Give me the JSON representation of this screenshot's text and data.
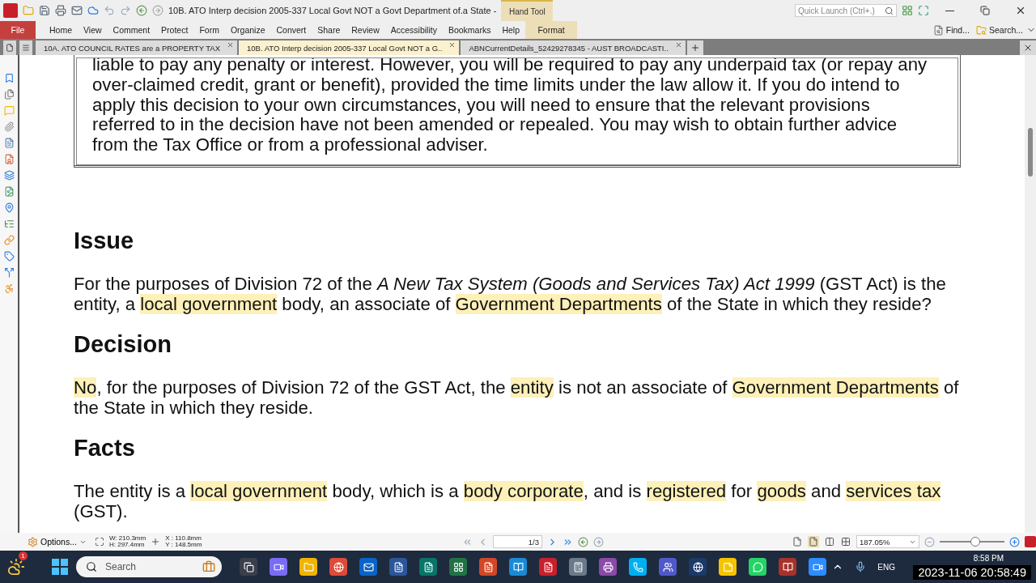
{
  "title_bar": {
    "title": "10B. ATO Interp decision 2005-337 Local Govt NOT a Govt Department of.a State -",
    "context_group": "Hand Tool",
    "quick_launch": {
      "placeholder": "Quick Launch (Ctrl+.)"
    }
  },
  "menu": {
    "file": "File",
    "items": [
      "Home",
      "View",
      "Comment",
      "Protect",
      "Form",
      "Organize",
      "Convert",
      "Share",
      "Review",
      "Accessibility",
      "Bookmarks",
      "Help"
    ],
    "context_tab": "Format",
    "tools": [
      "Find...",
      "Search..."
    ]
  },
  "doc_tabs": [
    {
      "label": "10A. ATO COUNCIL RATES are a PROPERTY TAX",
      "selected": false
    },
    {
      "label": "10B. ATO Interp decision 2005-337 Local Govt NOT a G..",
      "selected": true
    },
    {
      "label": "ABNCurrentDetails_52429278345 - AUST BROADCASTI..",
      "selected": false
    }
  ],
  "document": {
    "notice": "liable to pay any penalty or interest. However, you will be required to pay any underpaid tax (or repay any over-claimed credit, grant or benefit), provided the time limits under the law allow it. If you do intend to apply this decision to your own circumstances, you will need to ensure that the relevant provisions referred to in the decision have not been amended or repealed. You may wish to obtain further advice from the Tax Office or from a professional adviser.",
    "sections": [
      {
        "heading": "Issue",
        "paragraph": [
          {
            "kind": "plain",
            "text": "For the purposes of Division 72 of the "
          },
          {
            "kind": "italic",
            "text": "A New Tax System (Goods and Services Tax) Act 1999"
          },
          {
            "kind": "plain",
            "text": " (GST Act) is the entity, a "
          },
          {
            "kind": "highlight",
            "text": "local government"
          },
          {
            "kind": "plain",
            "text": " body, an associate of "
          },
          {
            "kind": "highlight",
            "text": "Government Departments"
          },
          {
            "kind": "plain",
            "text": " of the State in which they reside?"
          }
        ]
      },
      {
        "heading": "Decision",
        "paragraph": [
          {
            "kind": "highlight",
            "text": "No"
          },
          {
            "kind": "plain",
            "text": ", for the purposes of Division 72 of the GST Act, the "
          },
          {
            "kind": "highlight",
            "text": "entity"
          },
          {
            "kind": "plain",
            "text": " is not an associate of "
          },
          {
            "kind": "highlight",
            "text": "Government Departments"
          },
          {
            "kind": "plain",
            "text": " of the State in which they reside."
          }
        ]
      },
      {
        "heading": "Facts",
        "paragraph": [
          {
            "kind": "plain",
            "text": "The entity is a "
          },
          {
            "kind": "highlight",
            "text": "local government"
          },
          {
            "kind": "plain",
            "text": " body, which is a "
          },
          {
            "kind": "highlight",
            "text": "body corporate"
          },
          {
            "kind": "plain",
            "text": ", and is "
          },
          {
            "kind": "highlight",
            "text": "registered"
          },
          {
            "kind": "plain",
            "text": " for "
          },
          {
            "kind": "highlight",
            "text": "goods"
          },
          {
            "kind": "plain",
            "text": " and "
          },
          {
            "kind": "highlight",
            "text": "services tax"
          },
          {
            "kind": "plain",
            "text": " (GST)."
          }
        ]
      }
    ]
  },
  "status_bar": {
    "options": "Options...",
    "width": "W: 210.3mm",
    "height": "H: 297.4mm",
    "x": "X : 110.8mm",
    "y": "Y : 148.5mm",
    "page": "1/3",
    "zoom": "187.05%",
    "zoom_slider": {
      "level": 0.55
    }
  },
  "taskbar": {
    "weather_badge": "1",
    "search": {
      "placeholder": "Search"
    },
    "language": "ENG",
    "time": "8:58 PM",
    "timestamp_overlay": "2023-11-06 20:58:49"
  }
}
